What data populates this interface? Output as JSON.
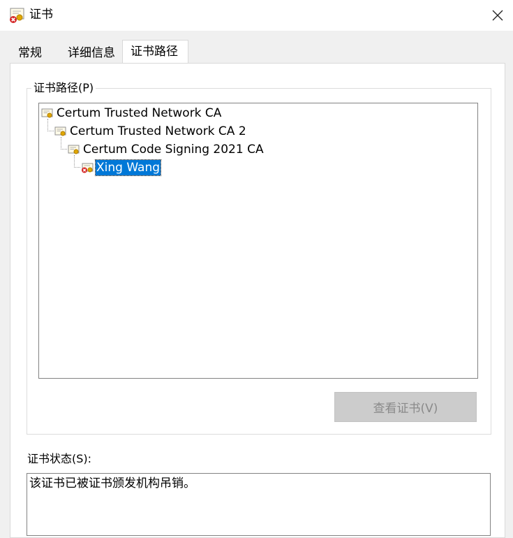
{
  "window": {
    "title": "证书",
    "title_icon": "certificate-revoked-icon",
    "close_icon": "close-icon"
  },
  "tabs": [
    {
      "label": "常规",
      "selected": false
    },
    {
      "label": "详细信息",
      "selected": false
    },
    {
      "label": "证书路径",
      "selected": true
    }
  ],
  "cert_path": {
    "group_label": "证书路径(P)",
    "items": [
      {
        "label": "Certum Trusted Network CA",
        "level": 0,
        "icon": "certificate-icon",
        "selected": false
      },
      {
        "label": "Certum Trusted Network CA 2",
        "level": 1,
        "icon": "certificate-icon",
        "selected": false
      },
      {
        "label": "Certum Code Signing 2021 CA",
        "level": 2,
        "icon": "certificate-icon",
        "selected": false
      },
      {
        "label": "Xing Wang",
        "level": 3,
        "icon": "certificate-revoked-icon",
        "selected": true
      }
    ],
    "view_button_label": "查看证书(V)",
    "view_button_enabled": false
  },
  "status": {
    "label": "证书状态(S):",
    "text": "该证书已被证书颁发机构吊销。"
  },
  "colors": {
    "selection": "#0078d7",
    "window_bg": "#f0f0f0",
    "revoked_mark": "#d42424",
    "seal": "#e0a800"
  }
}
